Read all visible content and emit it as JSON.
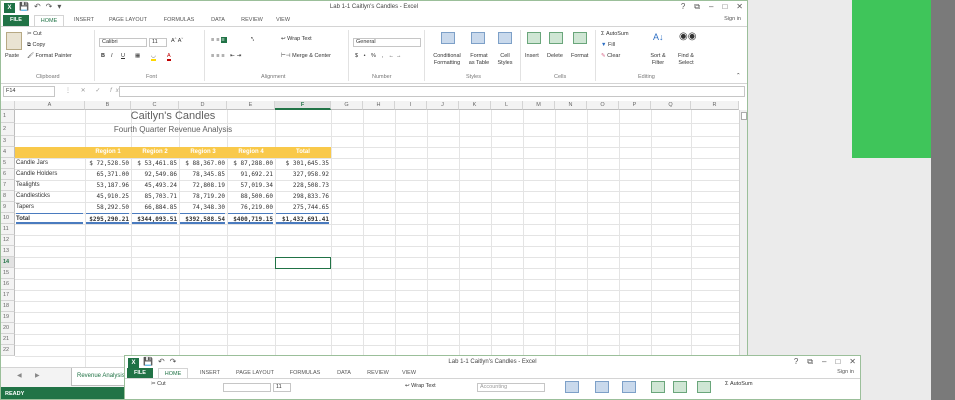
{
  "main_window": {
    "title": "Lab 1-1 Caitlyn's Candles - Excel",
    "window_controls": [
      "?",
      "⧉",
      "–",
      "□",
      "✕"
    ],
    "sign_in": "Sign in",
    "tabs": [
      "FILE",
      "HOME",
      "INSERT",
      "PAGE LAYOUT",
      "FORMULAS",
      "DATA",
      "REVIEW",
      "VIEW"
    ],
    "ribbon": {
      "clipboard": {
        "cut": "Cut",
        "copy": "Copy",
        "paste": "Paste",
        "format_painter": "Format Painter",
        "label": "Clipboard"
      },
      "font": {
        "name": "Calibri",
        "size": "11",
        "label": "Font",
        "bold": "B",
        "italic": "I",
        "underline": "U"
      },
      "alignment": {
        "wrap_text": "Wrap Text",
        "merge_center": "Merge & Center",
        "label": "Alignment"
      },
      "number": {
        "format": "General",
        "label": "Number"
      },
      "styles": {
        "conditional": "Conditional Formatting",
        "format_as_table": "Format as Table",
        "cell_styles": "Cell Styles",
        "label": "Styles"
      },
      "cells": {
        "insert": "Insert",
        "delete": "Delete",
        "format": "Format",
        "label": "Cells"
      },
      "editing": {
        "autosum": "AutoSum",
        "fill": "Fill",
        "clear": "Clear",
        "sort_filter": "Sort & Filter",
        "find_select": "Find & Select",
        "label": "Editing"
      }
    },
    "name_box": "F14",
    "fx": "fx",
    "columns": [
      "A",
      "B",
      "C",
      "D",
      "E",
      "F",
      "G",
      "H",
      "I",
      "J",
      "K",
      "L",
      "M",
      "N",
      "O",
      "P",
      "Q",
      "R"
    ],
    "rows": [
      "1",
      "2",
      "3",
      "4",
      "5",
      "6",
      "7",
      "8",
      "9",
      "10",
      "11",
      "12",
      "13",
      "14",
      "15",
      "16",
      "17",
      "18",
      "19",
      "20",
      "21",
      "22"
    ],
    "sheet": {
      "title": "Caitlyn's Candles",
      "subtitle": "Fourth Quarter Revenue Analysis",
      "headers": [
        "Region 1",
        "Region 2",
        "Region 3",
        "Region 4",
        "Total"
      ],
      "data": [
        [
          "Candle Jars",
          "$ 72,528.50",
          "$ 53,461.85",
          "$ 88,367.00",
          "$ 87,288.00",
          "$ 301,645.35"
        ],
        [
          "Candle Holders",
          "65,371.00",
          "92,549.86",
          "78,345.85",
          "91,692.21",
          "327,958.92"
        ],
        [
          "Tealights",
          "53,187.96",
          "45,493.24",
          "72,808.19",
          "57,019.34",
          "228,508.73"
        ],
        [
          "Candlesticks",
          "45,910.25",
          "85,703.71",
          "78,719.20",
          "88,500.60",
          "298,833.76"
        ],
        [
          "Tapers",
          "58,292.50",
          "66,884.85",
          "74,348.30",
          "76,219.00",
          "275,744.65"
        ],
        [
          "Total",
          "$295,290.21",
          "$344,093.51",
          "$392,588.54",
          "$400,719.15",
          "$1,432,691.41"
        ]
      ]
    },
    "sheet_tab": "Revenue Analysis",
    "status": "READY"
  },
  "second_window": {
    "title": "Lab 1-1 Caitlyn's Candles - Excel",
    "sign_in": "Sign in",
    "tabs": [
      "FILE",
      "HOME",
      "INSERT",
      "PAGE LAYOUT",
      "FORMULAS",
      "DATA",
      "REVIEW",
      "VIEW"
    ],
    "cut": "Cut",
    "font_size": "11",
    "wrap_text": "Wrap Text",
    "number_format": "Accounting",
    "autosum": "AutoSum"
  },
  "colors": {
    "excel_green": "#217346",
    "header_yellow": "#f9c94a",
    "deco_green": "#3fc55a",
    "deco_gray": "#7a7a7a"
  }
}
